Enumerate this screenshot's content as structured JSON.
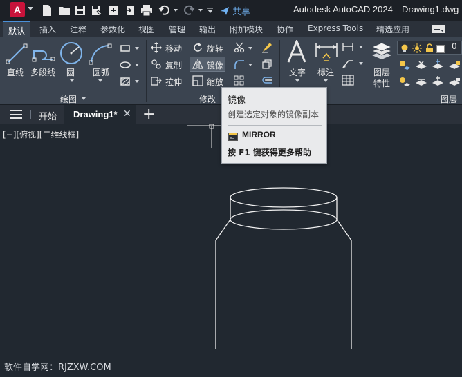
{
  "titlebar": {
    "logo_letter": "A",
    "share_label": "共享",
    "app_title": "Autodesk AutoCAD 2024",
    "doc_title": "Drawing1.dwg"
  },
  "ribbon_tabs": [
    "默认",
    "插入",
    "注释",
    "参数化",
    "视图",
    "管理",
    "输出",
    "附加模块",
    "协作",
    "Express Tools",
    "精选应用"
  ],
  "draw_panel": {
    "line": "直线",
    "polyline": "多段线",
    "circle": "圆",
    "arc": "圆弧",
    "panel_title": "绘图"
  },
  "modify_panel": {
    "move": "移动",
    "rotate": "旋转",
    "copy": "复制",
    "mirror": "镜像",
    "stretch": "拉伸",
    "scale": "缩放",
    "panel_title": "修改"
  },
  "annotation_panel": {
    "text": "文字",
    "dimension": "标注"
  },
  "layers_panel": {
    "layer_properties_line1": "图层",
    "layer_properties_line2": "特性",
    "layer_value": "0",
    "panel_title": "图层"
  },
  "file_tabs": {
    "start": "开始",
    "active": "Drawing1*"
  },
  "viewport": {
    "label": "[−][俯视][二维线框]"
  },
  "tooltip": {
    "title": "镜像",
    "description": "创建选定对象的镜像副本",
    "command": "MIRROR",
    "help": "按 F1 键获得更多帮助"
  },
  "watermark": "软件自学网：RJZXW.COM"
}
